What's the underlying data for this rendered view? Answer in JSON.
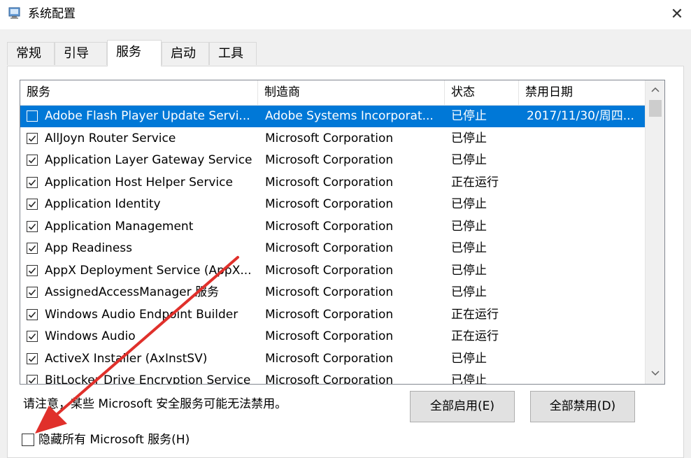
{
  "window": {
    "title": "系统配置",
    "close_glyph": "✕",
    "icon": "msconfig-icon"
  },
  "tabs": [
    {
      "label": "常规"
    },
    {
      "label": "引导"
    },
    {
      "label": "服务"
    },
    {
      "label": "启动"
    },
    {
      "label": "工具"
    }
  ],
  "active_tab": "服务",
  "columns": {
    "service": "服务",
    "manufacturer": "制造商",
    "status": "状态",
    "disabled_date": "禁用日期"
  },
  "services": [
    {
      "name": "Adobe Flash Player Update Servi...",
      "manufacturer": "Adobe Systems Incorporat...",
      "status": "已停止",
      "date": "2017/11/30/周四...",
      "checked": false,
      "selected": true
    },
    {
      "name": "AllJoyn Router Service",
      "manufacturer": "Microsoft Corporation",
      "status": "已停止",
      "date": "",
      "checked": true
    },
    {
      "name": "Application Layer Gateway Service",
      "manufacturer": "Microsoft Corporation",
      "status": "已停止",
      "date": "",
      "checked": true
    },
    {
      "name": "Application Host Helper Service",
      "manufacturer": "Microsoft Corporation",
      "status": "正在运行",
      "date": "",
      "checked": true
    },
    {
      "name": "Application Identity",
      "manufacturer": "Microsoft Corporation",
      "status": "已停止",
      "date": "",
      "checked": true
    },
    {
      "name": "Application Management",
      "manufacturer": "Microsoft Corporation",
      "status": "已停止",
      "date": "",
      "checked": true
    },
    {
      "name": "App Readiness",
      "manufacturer": "Microsoft Corporation",
      "status": "已停止",
      "date": "",
      "checked": true
    },
    {
      "name": "AppX Deployment Service (AppX...",
      "manufacturer": "Microsoft Corporation",
      "status": "已停止",
      "date": "",
      "checked": true
    },
    {
      "name": "AssignedAccessManager 服务",
      "manufacturer": "Microsoft Corporation",
      "status": "已停止",
      "date": "",
      "checked": true
    },
    {
      "name": "Windows Audio Endpoint Builder",
      "manufacturer": "Microsoft Corporation",
      "status": "正在运行",
      "date": "",
      "checked": true
    },
    {
      "name": "Windows Audio",
      "manufacturer": "Microsoft Corporation",
      "status": "正在运行",
      "date": "",
      "checked": true
    },
    {
      "name": "ActiveX Installer (AxInstSV)",
      "manufacturer": "Microsoft Corporation",
      "status": "已停止",
      "date": "",
      "checked": true
    },
    {
      "name": "BitLocker Drive Encryption Service",
      "manufacturer": "Microsoft Corporation",
      "status": "已停止",
      "date": "",
      "checked": true
    }
  ],
  "note": "请注意，某些 Microsoft 安全服务可能无法禁用。",
  "buttons": {
    "enable_all": "全部启用(E)",
    "disable_all": "全部禁用(D)"
  },
  "hide_ms": {
    "label": "隐藏所有 Microsoft 服务(H)",
    "checked": false
  },
  "colors": {
    "selection": "#0078d7",
    "annotation_arrow": "#e0302b"
  }
}
